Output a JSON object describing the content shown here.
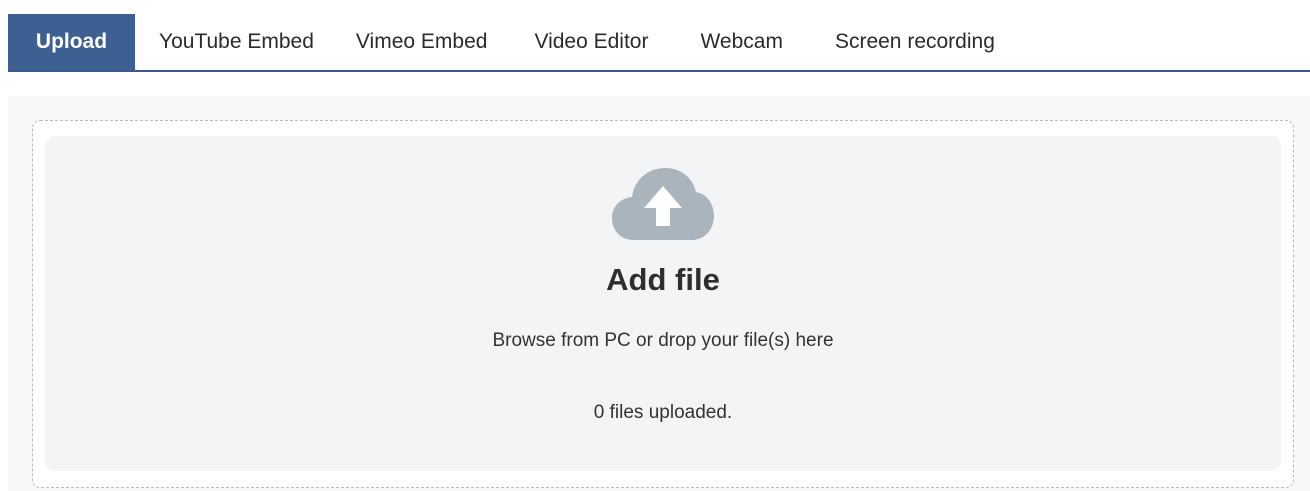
{
  "tabs": [
    {
      "label": "Upload",
      "active": true
    },
    {
      "label": "YouTube Embed",
      "active": false
    },
    {
      "label": "Vimeo Embed",
      "active": false
    },
    {
      "label": "Video Editor",
      "active": false
    },
    {
      "label": "Webcam",
      "active": false
    },
    {
      "label": "Screen recording",
      "active": false
    }
  ],
  "dropzone": {
    "icon": "cloud-upload-icon",
    "title": "Add file",
    "instructions": "Browse from PC or drop your file(s) here",
    "status": "0 files uploaded."
  },
  "colors": {
    "accent": "#3d5f92",
    "icon": "#aab4bd",
    "dropzone_bg": "#f3f4f6"
  }
}
